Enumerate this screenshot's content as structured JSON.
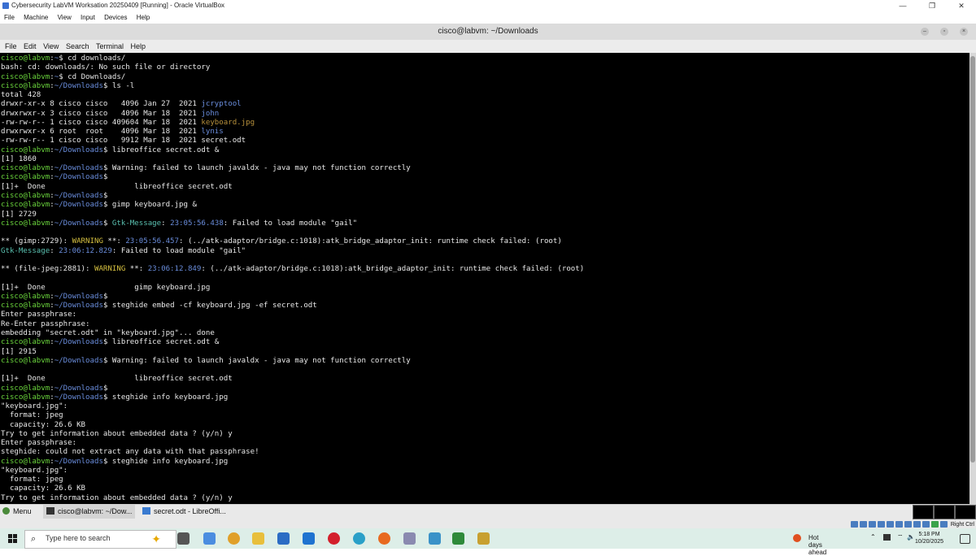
{
  "vbox": {
    "title": "Cybersecurity LabVM Worksation 20250409 [Running] - Oracle VirtualBox",
    "menu": [
      "File",
      "Machine",
      "View",
      "Input",
      "Devices",
      "Help"
    ],
    "controls": {
      "minimize": "—",
      "restore": "❐",
      "close": "✕"
    }
  },
  "terminal": {
    "title": "cisco@labvm: ~/Downloads",
    "menu": [
      "File",
      "Edit",
      "View",
      "Search",
      "Terminal",
      "Help"
    ],
    "prompt_user": "cisco@labvm",
    "lines": [
      {
        "prompt": "~",
        "cmd": "cd downloads/"
      },
      {
        "text": "bash: cd: downloads/: No such file or directory"
      },
      {
        "prompt": "~",
        "cmd": "cd Downloads/"
      },
      {
        "prompt": "~/Downloads",
        "cmd": "ls -l"
      },
      {
        "text": "total 428"
      },
      {
        "ls": "drwxr-xr-x 8 cisco cisco   4096 Jan 27  2021 ",
        "name": "jcryptool",
        "kind": "dir"
      },
      {
        "ls": "drwxrwxr-x 3 cisco cisco   4096 Mar 18  2021 ",
        "name": "john",
        "kind": "dir"
      },
      {
        "ls": "-rw-rw-r-- 1 cisco cisco 409604 Mar 18  2021 ",
        "name": "keyboard.jpg",
        "kind": "img"
      },
      {
        "ls": "drwxrwxr-x 6 root  root    4096 Mar 18  2021 ",
        "name": "lynis",
        "kind": "dir"
      },
      {
        "ls": "-rw-rw-r-- 1 cisco cisco   9912 Mar 18  2021 ",
        "name": "secret.odt",
        "kind": "file"
      },
      {
        "prompt": "~/Downloads",
        "cmd": "libreoffice secret.odt &"
      },
      {
        "text": "[1] 1860"
      },
      {
        "prompt": "~/Downloads",
        "cmd": "Warning: failed to launch javaldx - java may not function correctly"
      },
      {
        "prompt": "~/Downloads",
        "cmd": ""
      },
      {
        "text": "[1]+  Done                    libreoffice secret.odt"
      },
      {
        "prompt": "~/Downloads",
        "cmd": ""
      },
      {
        "prompt": "~/Downloads",
        "cmd": "gimp keyboard.jpg &"
      },
      {
        "text": "[1] 2729"
      },
      {
        "prompt": "~/Downloads",
        "cmd": "",
        "gtk": "Gtk-Message",
        "ts": "23:05:56.438",
        "rest": ": Failed to load module \"gail\""
      },
      {
        "text": ""
      },
      {
        "pre": "** (gimp:2729): ",
        "warn": "WARNING",
        "mid": " **: ",
        "ts": "23:05:56.457",
        "rest": ": (../atk-adaptor/bridge.c:1018):atk_bridge_adaptor_init: runtime check failed: (root)"
      },
      {
        "gtk": "Gtk-Message",
        "ts": "23:06:12.829",
        "rest": ": Failed to load module \"gail\""
      },
      {
        "text": ""
      },
      {
        "pre": "** (file-jpeg:2881): ",
        "warn": "WARNING",
        "mid": " **: ",
        "ts": "23:06:12.849",
        "rest": ": (../atk-adaptor/bridge.c:1018):atk_bridge_adaptor_init: runtime check failed: (root)"
      },
      {
        "text": ""
      },
      {
        "text": "[1]+  Done                    gimp keyboard.jpg"
      },
      {
        "prompt": "~/Downloads",
        "cmd": ""
      },
      {
        "prompt": "~/Downloads",
        "cmd": "steghide embed -cf keyboard.jpg -ef secret.odt"
      },
      {
        "text": "Enter passphrase:"
      },
      {
        "text": "Re-Enter passphrase:"
      },
      {
        "text": "embedding \"secret.odt\" in \"keyboard.jpg\"... done"
      },
      {
        "prompt": "~/Downloads",
        "cmd": "libreoffice secret.odt &"
      },
      {
        "text": "[1] 2915"
      },
      {
        "prompt": "~/Downloads",
        "cmd": "Warning: failed to launch javaldx - java may not function correctly"
      },
      {
        "text": ""
      },
      {
        "text": "[1]+  Done                    libreoffice secret.odt"
      },
      {
        "prompt": "~/Downloads",
        "cmd": ""
      },
      {
        "prompt": "~/Downloads",
        "cmd": "steghide info keyboard.jpg"
      },
      {
        "text": "\"keyboard.jpg\":"
      },
      {
        "text": "  format: jpeg"
      },
      {
        "text": "  capacity: 26.6 KB"
      },
      {
        "text": "Try to get information about embedded data ? (y/n) y"
      },
      {
        "text": "Enter passphrase:"
      },
      {
        "text": "steghide: could not extract any data with that passphrase!"
      },
      {
        "prompt": "~/Downloads",
        "cmd": "steghide info keyboard.jpg"
      },
      {
        "text": "\"keyboard.jpg\":"
      },
      {
        "text": "  format: jpeg"
      },
      {
        "text": "  capacity: 26.6 KB"
      },
      {
        "text": "Try to get information about embedded data ? (y/n) y"
      }
    ]
  },
  "panel": {
    "menu_label": "Menu",
    "terminal_task": "cisco@labvm: ~/Dow...",
    "writer_task": "secret.odt - LibreOffi...",
    "host_key": "Right Ctrl"
  },
  "taskbar": {
    "search_placeholder": "Type here to search",
    "weather": "Hot days ahead",
    "time": "5:18 PM",
    "date": "10/20/2025"
  },
  "colors": {
    "prompt_user": "#6ad43c",
    "prompt_path": "#6a8ddc",
    "warning": "#d6c040",
    "image_file": "#b8913c"
  }
}
